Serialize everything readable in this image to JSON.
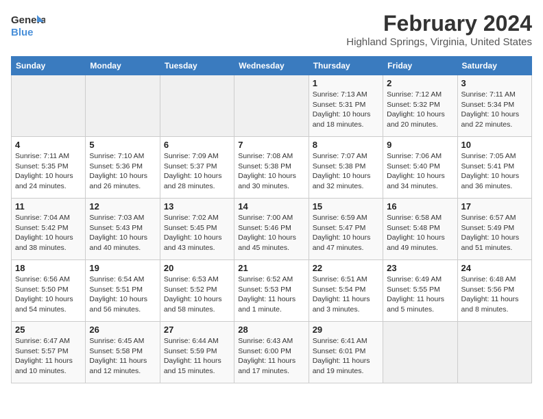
{
  "logo": {
    "line1": "General",
    "line2": "Blue"
  },
  "title": "February 2024",
  "subtitle": "Highland Springs, Virginia, United States",
  "days_of_week": [
    "Sunday",
    "Monday",
    "Tuesday",
    "Wednesday",
    "Thursday",
    "Friday",
    "Saturday"
  ],
  "weeks": [
    [
      {
        "num": "",
        "content": ""
      },
      {
        "num": "",
        "content": ""
      },
      {
        "num": "",
        "content": ""
      },
      {
        "num": "",
        "content": ""
      },
      {
        "num": "1",
        "content": "Sunrise: 7:13 AM\nSunset: 5:31 PM\nDaylight: 10 hours\nand 18 minutes."
      },
      {
        "num": "2",
        "content": "Sunrise: 7:12 AM\nSunset: 5:32 PM\nDaylight: 10 hours\nand 20 minutes."
      },
      {
        "num": "3",
        "content": "Sunrise: 7:11 AM\nSunset: 5:34 PM\nDaylight: 10 hours\nand 22 minutes."
      }
    ],
    [
      {
        "num": "4",
        "content": "Sunrise: 7:11 AM\nSunset: 5:35 PM\nDaylight: 10 hours\nand 24 minutes."
      },
      {
        "num": "5",
        "content": "Sunrise: 7:10 AM\nSunset: 5:36 PM\nDaylight: 10 hours\nand 26 minutes."
      },
      {
        "num": "6",
        "content": "Sunrise: 7:09 AM\nSunset: 5:37 PM\nDaylight: 10 hours\nand 28 minutes."
      },
      {
        "num": "7",
        "content": "Sunrise: 7:08 AM\nSunset: 5:38 PM\nDaylight: 10 hours\nand 30 minutes."
      },
      {
        "num": "8",
        "content": "Sunrise: 7:07 AM\nSunset: 5:38 PM\nDaylight: 10 hours\nand 32 minutes."
      },
      {
        "num": "9",
        "content": "Sunrise: 7:06 AM\nSunset: 5:40 PM\nDaylight: 10 hours\nand 34 minutes."
      },
      {
        "num": "10",
        "content": "Sunrise: 7:05 AM\nSunset: 5:41 PM\nDaylight: 10 hours\nand 36 minutes."
      }
    ],
    [
      {
        "num": "11",
        "content": "Sunrise: 7:04 AM\nSunset: 5:42 PM\nDaylight: 10 hours\nand 38 minutes."
      },
      {
        "num": "12",
        "content": "Sunrise: 7:03 AM\nSunset: 5:43 PM\nDaylight: 10 hours\nand 40 minutes."
      },
      {
        "num": "13",
        "content": "Sunrise: 7:02 AM\nSunset: 5:45 PM\nDaylight: 10 hours\nand 43 minutes."
      },
      {
        "num": "14",
        "content": "Sunrise: 7:00 AM\nSunset: 5:46 PM\nDaylight: 10 hours\nand 45 minutes."
      },
      {
        "num": "15",
        "content": "Sunrise: 6:59 AM\nSunset: 5:47 PM\nDaylight: 10 hours\nand 47 minutes."
      },
      {
        "num": "16",
        "content": "Sunrise: 6:58 AM\nSunset: 5:48 PM\nDaylight: 10 hours\nand 49 minutes."
      },
      {
        "num": "17",
        "content": "Sunrise: 6:57 AM\nSunset: 5:49 PM\nDaylight: 10 hours\nand 51 minutes."
      }
    ],
    [
      {
        "num": "18",
        "content": "Sunrise: 6:56 AM\nSunset: 5:50 PM\nDaylight: 10 hours\nand 54 minutes."
      },
      {
        "num": "19",
        "content": "Sunrise: 6:54 AM\nSunset: 5:51 PM\nDaylight: 10 hours\nand 56 minutes."
      },
      {
        "num": "20",
        "content": "Sunrise: 6:53 AM\nSunset: 5:52 PM\nDaylight: 10 hours\nand 58 minutes."
      },
      {
        "num": "21",
        "content": "Sunrise: 6:52 AM\nSunset: 5:53 PM\nDaylight: 11 hours\nand 1 minute."
      },
      {
        "num": "22",
        "content": "Sunrise: 6:51 AM\nSunset: 5:54 PM\nDaylight: 11 hours\nand 3 minutes."
      },
      {
        "num": "23",
        "content": "Sunrise: 6:49 AM\nSunset: 5:55 PM\nDaylight: 11 hours\nand 5 minutes."
      },
      {
        "num": "24",
        "content": "Sunrise: 6:48 AM\nSunset: 5:56 PM\nDaylight: 11 hours\nand 8 minutes."
      }
    ],
    [
      {
        "num": "25",
        "content": "Sunrise: 6:47 AM\nSunset: 5:57 PM\nDaylight: 11 hours\nand 10 minutes."
      },
      {
        "num": "26",
        "content": "Sunrise: 6:45 AM\nSunset: 5:58 PM\nDaylight: 11 hours\nand 12 minutes."
      },
      {
        "num": "27",
        "content": "Sunrise: 6:44 AM\nSunset: 5:59 PM\nDaylight: 11 hours\nand 15 minutes."
      },
      {
        "num": "28",
        "content": "Sunrise: 6:43 AM\nSunset: 6:00 PM\nDaylight: 11 hours\nand 17 minutes."
      },
      {
        "num": "29",
        "content": "Sunrise: 6:41 AM\nSunset: 6:01 PM\nDaylight: 11 hours\nand 19 minutes."
      },
      {
        "num": "",
        "content": ""
      },
      {
        "num": "",
        "content": ""
      }
    ]
  ]
}
